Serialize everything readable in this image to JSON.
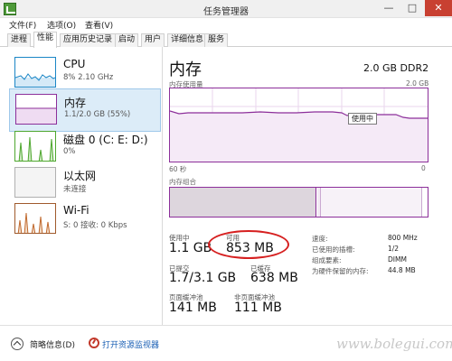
{
  "window": {
    "title": "任务管理器"
  },
  "menu": [
    "文件(F)",
    "选项(O)",
    "查看(V)"
  ],
  "tabs": [
    "进程",
    "性能",
    "应用历史记录",
    "启动",
    "用户",
    "详细信息",
    "服务"
  ],
  "active_tab": "性能",
  "sidebar": [
    {
      "name": "CPU",
      "sub": "8%  2.10 GHz",
      "graph": "cpu-graph",
      "color": "#1b86c6"
    },
    {
      "name": "内存",
      "sub": "1.1/2.0 GB (55%)",
      "graph": "memory-graph",
      "color": "#8c2f9a"
    },
    {
      "name": "磁盘 0 (C: E: D:)",
      "sub": "0%",
      "graph": "disk-graph",
      "color": "#4ea72e"
    },
    {
      "name": "以太网",
      "sub": "未连接",
      "graph": "ethernet-graph",
      "color": "#a05a2c"
    },
    {
      "name": "Wi-Fi",
      "sub": "S: 0 接收: 0 Kbps",
      "graph": "wifi-graph",
      "color": "#a05a2c"
    }
  ],
  "main": {
    "title": "内存",
    "spec": "2.0 GB DDR2",
    "usage_label": "内存使用量",
    "usage_max": "2.0 GB",
    "time_span": "60 秒",
    "axis_zero": "0",
    "tooltip": "使用中",
    "composition_label": "内存组合",
    "accent": "#8c2f9a"
  },
  "stats": {
    "in_use": {
      "label": "使用中",
      "value": "1.1 GB"
    },
    "available": {
      "label": "可用",
      "value": "853 MB"
    },
    "committed": {
      "label": "已提交",
      "value": "1.7/3.1 GB"
    },
    "cached": {
      "label": "已缓存",
      "value": "638 MB"
    },
    "paged_pool": {
      "label": "页面缓冲池",
      "value": "141 MB"
    },
    "non_paged_pool": {
      "label": "非页面缓冲池",
      "value": "111 MB"
    }
  },
  "props": [
    {
      "k": "速度:",
      "v": "800 MHz"
    },
    {
      "k": "已使用的插槽:",
      "v": "1/2"
    },
    {
      "k": "组成要素:",
      "v": "DIMM"
    },
    {
      "k": "为硬件保留的内存:",
      "v": "44.8 MB"
    }
  ],
  "bottom": {
    "fewer_details": "简略信息(D)",
    "open_monitor": "打开资源监视器"
  },
  "watermark": "www.bolegui.com"
}
